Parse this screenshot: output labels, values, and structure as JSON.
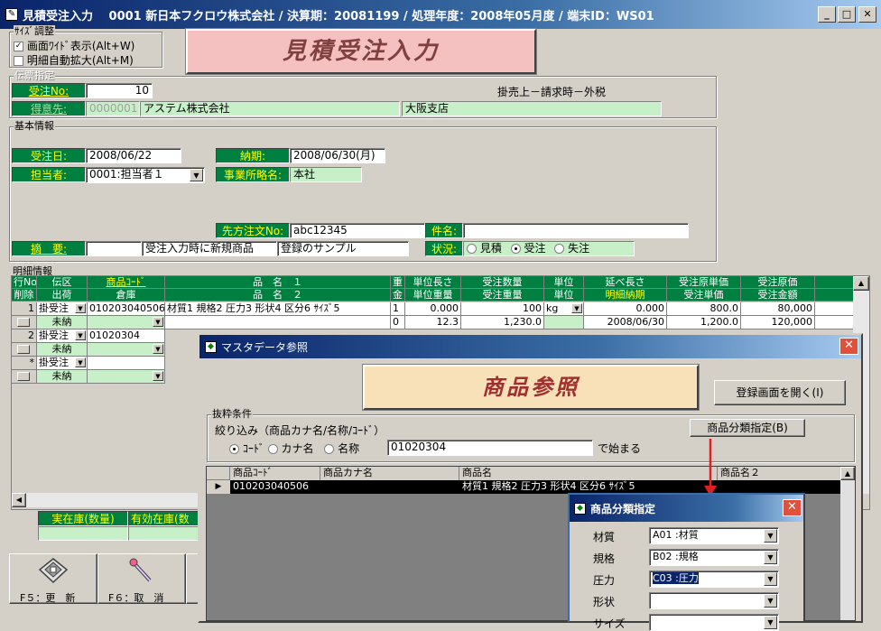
{
  "app": {
    "title": "見積受注入力　 0001 新日本フクロウ株式会社 / 決算期：20081199 / 処理年度：2008年05月度 / 端末ID：WS01"
  },
  "size_adjust": {
    "label": "ｻｲｽﾞ調整",
    "wide_display": "画面ﾜｲﾄﾞ表示(Alt+W)",
    "wide_checked": "✓",
    "auto_expand": "明細自動拡大(Alt+M)"
  },
  "banner": "見積受注入力",
  "den_shitei": {
    "label": "伝票指定",
    "order_no_label": "受注No:",
    "order_no": "10",
    "terms": "掛売上－請求時－外税",
    "customer_label": "得意先:",
    "customer_code": "0000001",
    "customer_name": "アステム株式会社",
    "branch": "大阪支店"
  },
  "basic": {
    "label": "基本情報",
    "order_date_label": "受注日:",
    "order_date": "2008/06/22",
    "due_label": "納期:",
    "due": "2008/06/30(月)",
    "staff_label": "担当者:",
    "staff": "0001:担当者１",
    "office_label": "事業所略名:",
    "office": "本社",
    "customer_order_label": "先方注文No:",
    "customer_order": "abc12345",
    "subject_label": "件名:",
    "subject": "",
    "summary_label": "摘　要:",
    "summary_code": "",
    "summary_text1": "受注入力時に新規商品",
    "summary_text2": "登録のサンプル",
    "status_label": "状況:",
    "status_options": [
      "見積",
      "受注",
      "失注"
    ]
  },
  "detail": {
    "label": "明細情報",
    "headers1": [
      "行No",
      "伝区",
      "商品ｺｰﾄﾞ",
      "品　名　１",
      "重",
      "単位長さ",
      "受注数量",
      "単位",
      "延べ長さ",
      "受注原単価",
      "受注原価"
    ],
    "headers2": [
      "削除",
      "出荷",
      "倉庫",
      "品　名　２",
      "金",
      "単位重量",
      "受注重量",
      "単位",
      "明細納期",
      "受注単価",
      "受注金額"
    ],
    "rows": [
      {
        "no": "1",
        "den": "掛受注",
        "code": "010203040506",
        "name1": "材質1 規格2 圧力3 形状4 区分6 ｻｲｽﾞ5",
        "wflag": "1",
        "unit_len": "0.000",
        "qty": "100",
        "unit": "kg",
        "total_len": "0.000",
        "cost_price": "800.0",
        "cost": "80,000",
        "ship": "未納",
        "wflag2": "0",
        "unit_wt": "12.3",
        "wt": "1,230.0",
        "due": "2008/06/30",
        "price": "1,200.0",
        "amount": "120,000"
      },
      {
        "no": "2",
        "den": "掛受注",
        "code": "01020304",
        "ship": "未納"
      },
      {
        "no": "*",
        "den": "掛受注",
        "code": "",
        "ship": "未納"
      }
    ],
    "stock_label": "実在庫(数量)",
    "avail_label": "有効在庫(数"
  },
  "fkeys": [
    {
      "label": "F５：更　新",
      "icon": "floppy-disk-icon"
    },
    {
      "label": "F６：取　消",
      "icon": "eraser-icon"
    }
  ],
  "master": {
    "title": "マスタデータ参照",
    "banner": "商品参照",
    "open_register": "登録画面を開く(I)",
    "filter_label": "抜粋条件",
    "filter_desc": "絞り込み（商品カナ名/名称/ｺｰﾄﾞ）",
    "filter_options": [
      "ｺｰﾄﾞ",
      "カナ名",
      "名称"
    ],
    "filter_value": "01020304",
    "suffix": "で始まる",
    "category_button": "商品分類指定(B)",
    "columns": [
      "商品ｺｰﾄﾞ",
      "商品カナ名",
      "商品名",
      "商品名２"
    ],
    "results": [
      {
        "code": "010203040506",
        "kana": "",
        "name": "材質1 規格2 圧力3 形状4 区分6 ｻｲｽﾞ5",
        "name2": ""
      }
    ]
  },
  "category": {
    "title": "商品分類指定",
    "fields": [
      {
        "label": "材質",
        "value": "A01 :材質"
      },
      {
        "label": "規格",
        "value": "B02 :規格"
      },
      {
        "label": "圧力",
        "value": "C03 :圧力"
      },
      {
        "label": "形状",
        "value": ""
      },
      {
        "label": "サイズ",
        "value": ""
      }
    ]
  }
}
